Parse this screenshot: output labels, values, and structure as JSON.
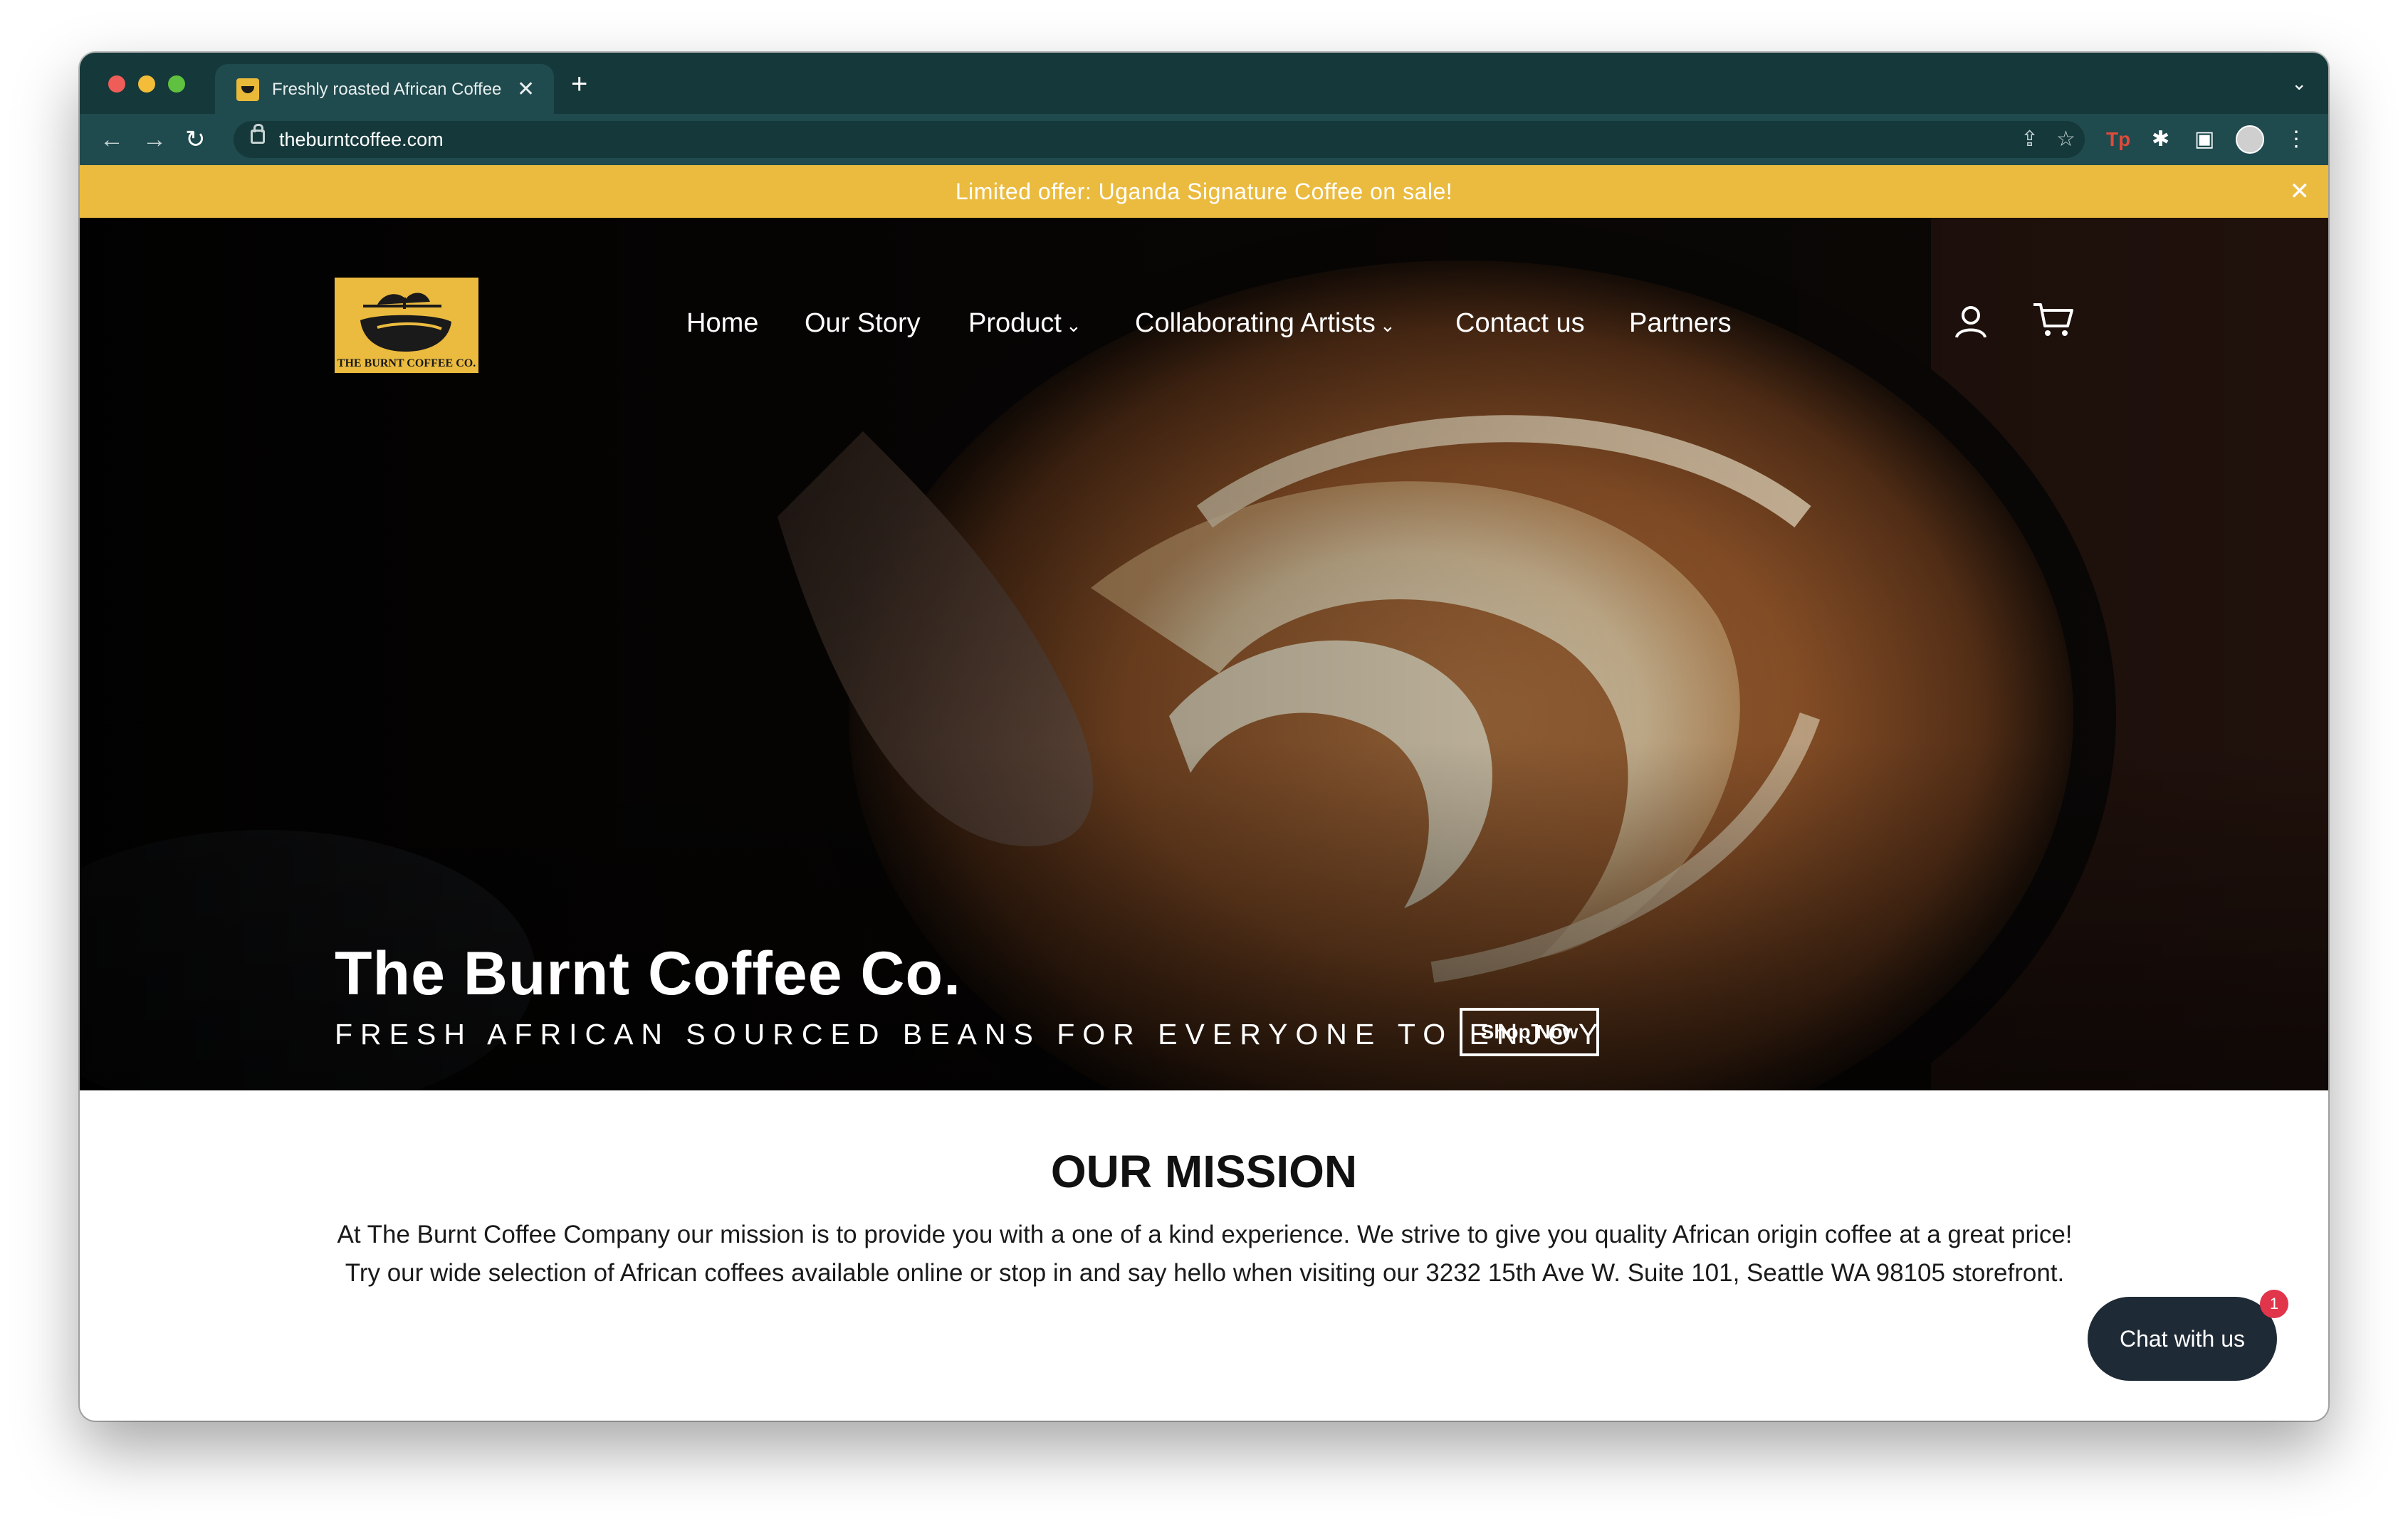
{
  "browser": {
    "tab_title": "Freshly roasted African Coffee",
    "tab_close": "✕",
    "new_tab": "+",
    "tab_menu": "⌄",
    "url": "theburntcoffee.com",
    "back": "←",
    "forward": "→",
    "reload": "↻",
    "share": "⇪",
    "bookmark": "☆",
    "extension_tp": "Tp",
    "extensions": "✱",
    "sidebar": "▣",
    "menu": "⋮"
  },
  "announcement": {
    "text": "Limited offer: Uganda Signature Coffee on sale!",
    "close": "✕"
  },
  "logo": {
    "text": "THE BURNT COFFEE CO."
  },
  "nav": {
    "items": [
      {
        "label": "Home"
      },
      {
        "label": "Our Story"
      },
      {
        "label": "Product",
        "caret": "⌄"
      },
      {
        "label": "Collaborating Artists",
        "caret": "⌄"
      },
      {
        "label": "Contact us"
      },
      {
        "label": "Partners"
      }
    ]
  },
  "hero": {
    "title": "The Burnt Coffee Co.",
    "subtitle": "FRESH AFRICAN SOURCED BEANS FOR EVERYONE TO ENJOY",
    "button": "Shop Now"
  },
  "mission": {
    "title": "OUR MISSION",
    "text": "At The Burnt Coffee Company our mission is to provide you with a one of a kind experience. We strive to give you quality African origin coffee at a great price! Try our wide selection of African coffees available online or stop in and say hello when visiting our 3232 15th Ave W. Suite 101, Seattle WA 98105 storefront."
  },
  "chat": {
    "label": "Chat with us",
    "badge": "1"
  },
  "colors": {
    "announcement": "#ebbb3f",
    "browser_frame": "#15383a",
    "chat_button": "#1e2a36",
    "badge": "#e0354a"
  }
}
